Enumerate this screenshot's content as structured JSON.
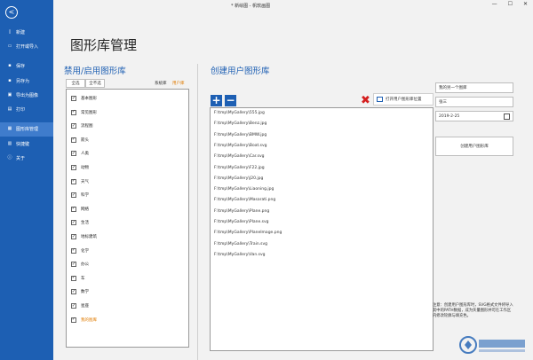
{
  "window": {
    "title": "* 新绘图 - 帆软画图"
  },
  "window_controls": {
    "minimize": "—",
    "maximize": "☐",
    "close": "✕"
  },
  "sidebar": {
    "back_glyph": "<",
    "items": [
      {
        "label": "新建",
        "icon": "new-file-icon",
        "glyph": "▯"
      },
      {
        "label": "打开或导入",
        "icon": "folder-icon",
        "glyph": "▭"
      },
      {
        "label": "保存",
        "icon": "save-icon",
        "glyph": "▪"
      },
      {
        "label": "另存为",
        "icon": "save-as-icon",
        "glyph": "▪"
      },
      {
        "label": "导出为图像",
        "icon": "export-icon",
        "glyph": "▣"
      },
      {
        "label": "打印",
        "icon": "print-icon",
        "glyph": "▤"
      },
      {
        "label": "图形库管理",
        "icon": "gallery-icon",
        "glyph": "▦"
      },
      {
        "label": "快捷键",
        "icon": "keyboard-icon",
        "glyph": "▥"
      },
      {
        "label": "关于",
        "icon": "info-icon",
        "glyph": "ⓘ"
      }
    ],
    "active_index": 6
  },
  "page": {
    "title": "图形库管理"
  },
  "left_panel": {
    "heading": "禁用/启用图形库",
    "select_all": "全选",
    "select_none": "全不选",
    "tab_system": "系统库",
    "tab_user": "用户库",
    "check_mark": "✓",
    "items": [
      "基本图形",
      "常见图形",
      "流程图",
      "箭头",
      "人类",
      "动物",
      "天气",
      "科学",
      "网络",
      "生活",
      "地标建筑",
      "化学",
      "办公",
      "车",
      "数学",
      "星座",
      "我的图库"
    ]
  },
  "right_panel": {
    "heading": "创建用户图形库",
    "add_glyph": "+",
    "remove_glyph": "−",
    "delete_glyph": "✖",
    "open_location_label": "打开用户图形库位置",
    "files": [
      "F:\\tmp\\MyGallery\\555.jpg",
      "F:\\tmp\\MyGallery\\Benz.jpg",
      "F:\\tmp\\MyGallery\\BMW.jpg",
      "F:\\tmp\\MyGallery\\Boat.svg",
      "F:\\tmp\\MyGallery\\Car.svg",
      "F:\\tmp\\MyGallery\\F22.jpg",
      "F:\\tmp\\MyGallery\\J20.jpg",
      "F:\\tmp\\MyGallery\\Liaoning.jpg",
      "F:\\tmp\\MyGallery\\Masarati.png",
      "F:\\tmp\\MyGallery\\Plane.png",
      "F:\\tmp\\MyGallery\\Plane.svg",
      "F:\\tmp\\MyGallery\\PlaneImage.png",
      "F:\\tmp\\MyGallery\\Train.svg",
      "F:\\tmp\\MyGallery\\Van.svg"
    ],
    "name_value": "我的另一个图库",
    "author_value": "张三",
    "date_value": "2019-2-25",
    "create_label": "创建用户图形库",
    "note": "注意：创建用户图形库时，SVG格式文件将导入其中的PATH数据，成为矢量图形并可在工作区内修改轮廓与填充色。"
  },
  "colors": {
    "accent": "#1d5fb3",
    "user_tab": "#e07b00",
    "delete": "#d41f1f"
  }
}
